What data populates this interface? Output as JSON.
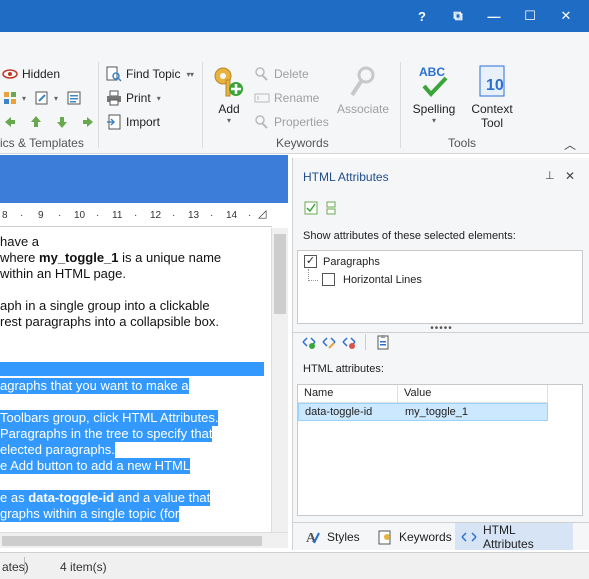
{
  "window": {
    "help_label": "?",
    "restore_label": "⧉",
    "minimize_label": "—",
    "maximize_label": "☐",
    "close_label": "✕"
  },
  "ribbon": {
    "hidden_label": "Hidden",
    "find_topic_label": "Find Topic",
    "print_label": "Print",
    "import_label": "Import",
    "add_label": "Add",
    "delete_label": "Delete",
    "rename_label": "Rename",
    "properties_label": "Properties",
    "associate_label": "Associate",
    "spelling_label": "Spelling",
    "context_tool_line1": "Context",
    "context_tool_line2": "Tool",
    "spelling_badge": "ABC",
    "groups": {
      "topics_templates": "ics & Templates",
      "keywords": "Keywords",
      "tools": "Tools"
    }
  },
  "ruler": {
    "ticks": [
      "8",
      "·",
      "9",
      "·",
      "10",
      "·",
      "11",
      "·",
      "12",
      "·",
      "13",
      "·",
      "14",
      "·"
    ]
  },
  "editor": {
    "lines": [
      {
        "pre": " have a",
        "bold": "",
        "post": "",
        "selected": false
      },
      {
        "pre": "where ",
        "bold": "my_toggle_1",
        "post": " is a unique name",
        "selected": false
      },
      {
        "pre": " within an HTML page.",
        "bold": "",
        "post": "",
        "selected": false
      },
      {
        "pre": "aph in a single group into a clickable",
        "bold": "",
        "post": "",
        "selected": false
      },
      {
        "pre": "rest paragraphs into a collapsible box.",
        "bold": "",
        "post": "",
        "selected": false
      },
      {
        "pre": "agraphs that you want to make a",
        "bold": "",
        "post": "",
        "selected": true
      },
      {
        "pre": " Toolbars group, click HTML Attributes.",
        "bold": "",
        "post": "",
        "selected": true
      },
      {
        "pre": "Paragraphs in the tree to specify that",
        "bold": "",
        "post": "",
        "selected": true
      },
      {
        "pre": "elected paragraphs.",
        "bold": "",
        "post": "",
        "selected": true
      },
      {
        "pre": "e Add button to add a new HTML",
        "bold": "",
        "post": "",
        "selected": true
      },
      {
        "pre": "e as ",
        "bold": "data-toggle-id",
        "post": " and a value that",
        "selected": true
      },
      {
        "pre": "graphs within a single topic (for",
        "bold": "",
        "post": "",
        "selected": true
      }
    ]
  },
  "statusbar": {
    "left_text": "ates)",
    "item_count": "4 item(s)"
  },
  "panel": {
    "title": "HTML Attributes",
    "pin_label": "⊥",
    "close_label": "✕",
    "show_attributes_label": "Show attributes of these selected elements:",
    "tree": [
      {
        "label": "Paragraphs",
        "checked": true
      },
      {
        "label": "Horizontal Lines",
        "checked": false
      }
    ],
    "html_attributes_label": "HTML attributes:",
    "table": {
      "col_name": "Name",
      "col_value": "Value",
      "rows": [
        {
          "name": "data-toggle-id",
          "value": "my_toggle_1"
        }
      ]
    },
    "tabs": [
      "Styles",
      "Keywords",
      "HTML Attributes"
    ],
    "active_tab": "HTML Attributes"
  },
  "colors": {
    "titlebar": "#1e6cc4",
    "selection": "#3399ff",
    "accent": "#1e4e8c"
  }
}
